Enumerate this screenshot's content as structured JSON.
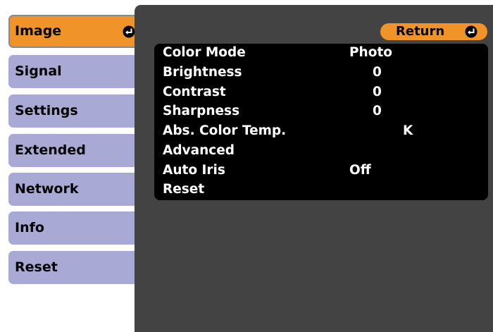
{
  "menu": {
    "items": [
      {
        "label": "Image",
        "active": true
      },
      {
        "label": "Signal",
        "active": false
      },
      {
        "label": "Settings",
        "active": false
      },
      {
        "label": "Extended",
        "active": false
      },
      {
        "label": "Network",
        "active": false
      },
      {
        "label": "Info",
        "active": false
      },
      {
        "label": "Reset",
        "active": false
      }
    ],
    "enter_icon": "enter-icon"
  },
  "panel": {
    "return_label": "Return",
    "rows": [
      {
        "label": "Color Mode",
        "value": "Photo"
      },
      {
        "label": "Brightness",
        "value": "0"
      },
      {
        "label": "Contrast",
        "value": "0"
      },
      {
        "label": "Sharpness",
        "value": "0"
      },
      {
        "label": "Abs. Color Temp.",
        "value": "K"
      },
      {
        "label": "Advanced",
        "value": ""
      },
      {
        "label": "Auto Iris",
        "value": "Off"
      },
      {
        "label": "Reset",
        "value": ""
      }
    ]
  },
  "colors": {
    "active_tab": "#f0942a",
    "inactive_tab": "#a9a9d6",
    "panel_bg": "#434343",
    "list_bg": "#000000",
    "text_light": "#ffffff"
  }
}
